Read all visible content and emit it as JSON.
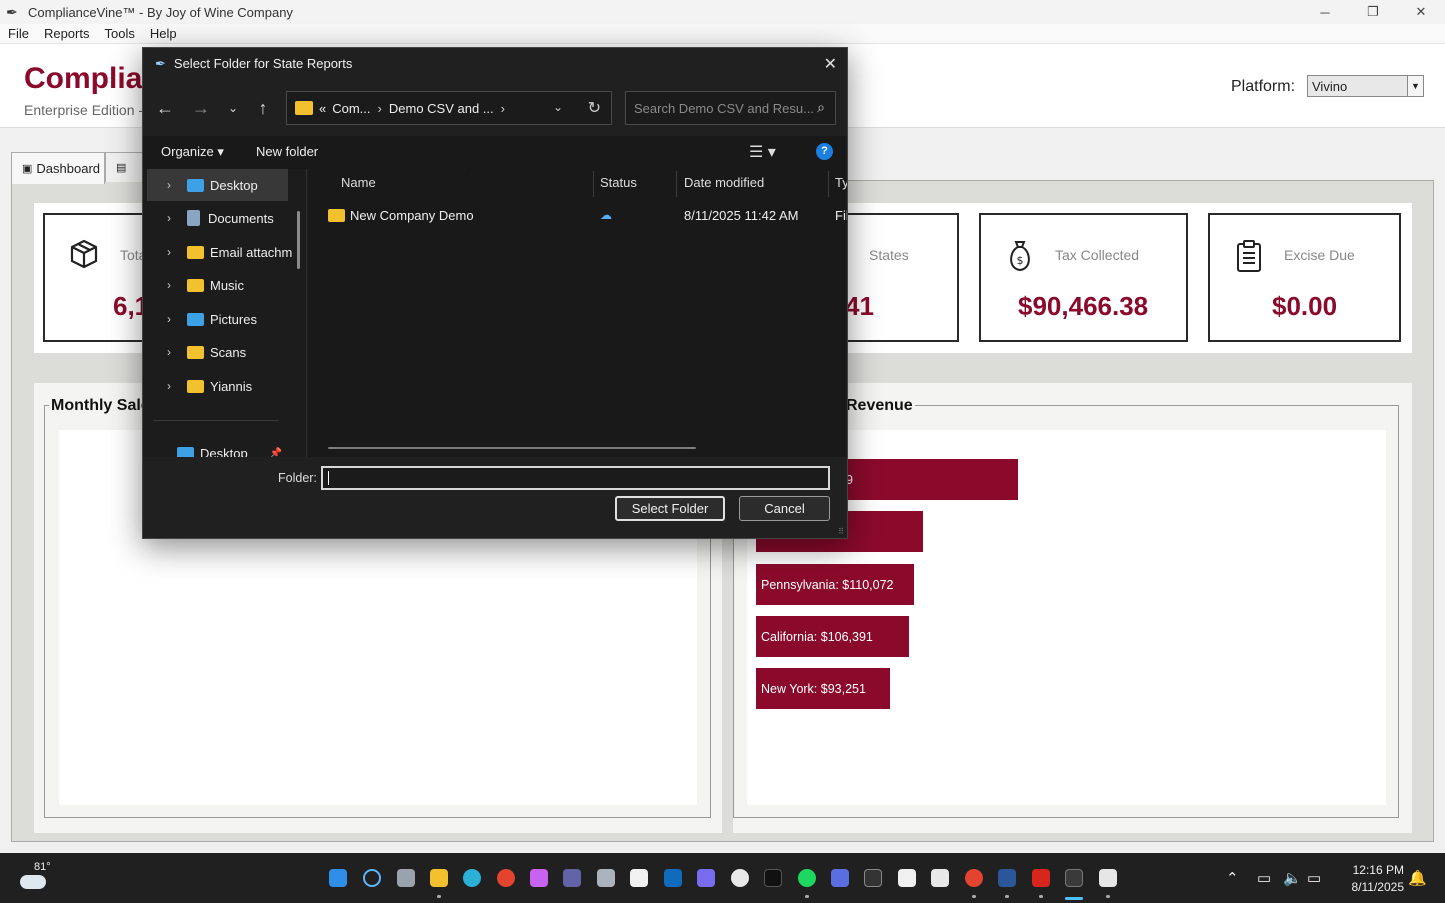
{
  "window": {
    "title": "ComplianceVine™ - By Joy of Wine Company",
    "controls": [
      "─",
      "❐",
      "✕"
    ]
  },
  "menu": [
    "File",
    "Reports",
    "Tools",
    "Help"
  ],
  "header": {
    "brand": "Complian",
    "edition": "Enterprise Edition -",
    "platform_label": "Platform:",
    "platform_value": "Vivino"
  },
  "tabs": [
    {
      "label": "Dashboard",
      "icon": "dashboard-icon"
    },
    {
      "label": "",
      "icon": "tab-icon"
    }
  ],
  "stats": [
    {
      "label": "Tota",
      "value": "6,1",
      "icon": "package-icon"
    },
    {
      "label": "States",
      "value": "41",
      "icon": "none"
    },
    {
      "label": "Tax Collected",
      "value": "$90,466.38",
      "icon": "money-bag-icon"
    },
    {
      "label": "Excise Due",
      "value": "$0.00",
      "icon": "clipboard-icon"
    }
  ],
  "charts": {
    "left_title": "Monthly Sale",
    "right_title": "Revenue"
  },
  "chart_data": {
    "type": "bar",
    "categories": [
      "",
      "",
      "Pennsylvania",
      "California",
      "New York"
    ],
    "values": [
      null,
      null,
      110072,
      106391,
      93251
    ],
    "labels": [
      "9",
      "",
      "Pennsylvania: $110,072",
      "California: $106,391",
      "New York: $93,251"
    ],
    "orientation": "horizontal",
    "color": "#8b0a2c"
  },
  "dialog": {
    "title": "Select Folder for State Reports",
    "close": "✕",
    "address": {
      "prefix": "«",
      "crumbs": [
        "Com...",
        "Demo CSV and ..."
      ],
      "sep": "›"
    },
    "search_placeholder": "Search Demo CSV and Resu...",
    "toolbar": {
      "organize": "Organize ▾",
      "new_folder": "New folder",
      "help": "?"
    },
    "nav_items": [
      {
        "label": "Desktop",
        "icon": "desktop-icon",
        "selected": true
      },
      {
        "label": "Documents",
        "icon": "documents-icon"
      },
      {
        "label": "Email attachm",
        "icon": "folder-icon"
      },
      {
        "label": "Music",
        "icon": "folder-icon"
      },
      {
        "label": "Pictures",
        "icon": "pictures-icon"
      },
      {
        "label": "Scans",
        "icon": "folder-icon"
      },
      {
        "label": "Yiannis",
        "icon": "folder-icon"
      }
    ],
    "quick_access": {
      "label": "Desktop",
      "pin": "📌"
    },
    "columns": [
      "Name",
      "Status",
      "Date modified",
      "Ty"
    ],
    "files": [
      {
        "name": "New Company Demo",
        "status": "☁",
        "date": "8/11/2025 11:42 AM",
        "type": "Fil"
      }
    ],
    "folder_label": "Folder:",
    "folder_value": "",
    "select_button": "Select Folder",
    "cancel_button": "Cancel"
  },
  "taskbar": {
    "temperature": "81°",
    "time": "12:16 PM",
    "date": "8/11/2025"
  }
}
